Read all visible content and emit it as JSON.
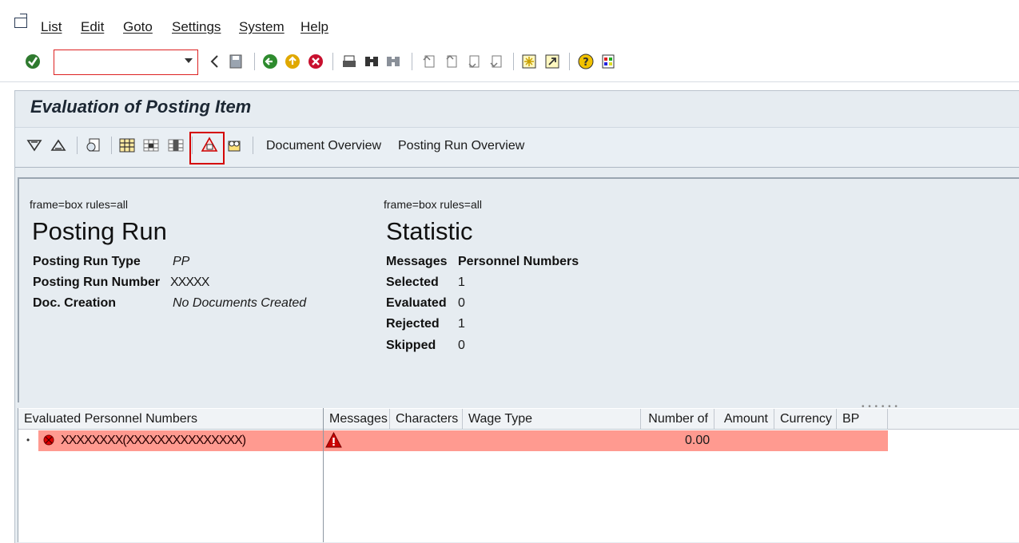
{
  "menu": {
    "items": [
      "List",
      "Edit",
      "Goto",
      "Settings",
      "System",
      "Help"
    ]
  },
  "command_field": {
    "value": "",
    "placeholder": ""
  },
  "window": {
    "title": "Evaluation of Posting Item"
  },
  "app_toolbar": {
    "buttons": [
      "Document Overview",
      "Posting Run Overview"
    ],
    "highlight_color": "#d40000"
  },
  "posting_run": {
    "frame_note": "frame=box rules=all",
    "heading": "Posting Run",
    "rows": [
      {
        "label": "Posting Run Type",
        "value": "PP"
      },
      {
        "label": "Posting Run Number",
        "value": "XXXXX"
      },
      {
        "label": "Doc. Creation",
        "value": "No Documents Created"
      }
    ]
  },
  "statistic": {
    "frame_note": "frame=box rules=all",
    "heading": "Statistic",
    "header": {
      "label": "Messages",
      "value": "Personnel Numbers"
    },
    "rows": [
      {
        "label": "Selected",
        "value": "1"
      },
      {
        "label": "Evaluated",
        "value": "0"
      },
      {
        "label": "Rejected",
        "value": "1"
      },
      {
        "label": "Skipped",
        "value": "0"
      }
    ]
  },
  "tree": {
    "columns": [
      "Evaluated Personnel Numbers",
      "Messages",
      "Characters",
      "Wage Type",
      "Number of",
      "Amount",
      "Currency",
      "BP"
    ],
    "rows": [
      {
        "name": "XXXXXXXX(XXXXXXXXXXXXXXX)",
        "amount": "0.00"
      }
    ],
    "error_row_color": "#ff9a90"
  }
}
